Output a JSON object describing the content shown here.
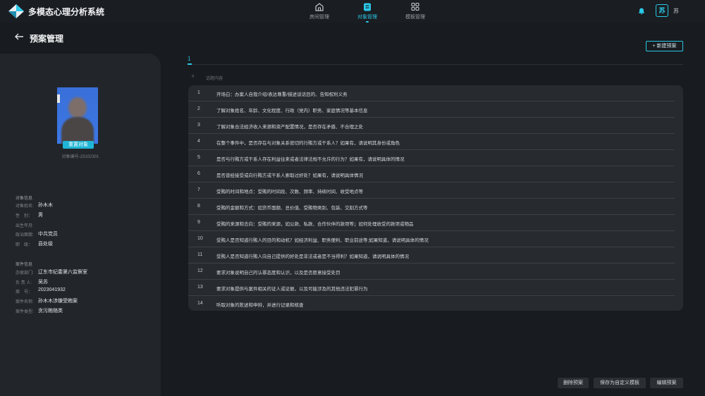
{
  "app": {
    "title": "多模态心理分析系统"
  },
  "nav": {
    "items": [
      {
        "label": "房间管理",
        "icon": "home-icon"
      },
      {
        "label": "对象管理",
        "icon": "person-card-icon"
      },
      {
        "label": "模板管理",
        "icon": "template-icon"
      }
    ],
    "active_index": 1
  },
  "user": {
    "avatar_text": "苏",
    "name": "苏"
  },
  "page": {
    "title": "预案管理"
  },
  "object": {
    "reset_label": "重置对象",
    "id_text": "对象编号-23102301",
    "info_title": "对象信息",
    "fields": [
      {
        "k": "对象姓名:",
        "v": "孙木木"
      },
      {
        "k": "性　别：",
        "v": "男"
      },
      {
        "k": "出生年月:",
        "v": ""
      },
      {
        "k": "政治面貌:",
        "v": "中共党员"
      },
      {
        "k": "职　级：",
        "v": "县处级"
      }
    ]
  },
  "case": {
    "info_title": "案件信息",
    "fields": [
      {
        "k": "办案部门:",
        "v": "辽东市纪委第六监察室"
      },
      {
        "k": "负 责 人:",
        "v": "吴苏"
      },
      {
        "k": "案　号：",
        "v": "2023041932"
      },
      {
        "k": "案件名称:",
        "v": "孙木木涉嫌受贿案"
      },
      {
        "k": "案件类型:",
        "v": "贪污贿赂类"
      }
    ]
  },
  "toolbar": {
    "new_label": "+ 新建预案"
  },
  "tabs": [
    {
      "label": "1"
    }
  ],
  "table": {
    "headers": {
      "no": "#",
      "content": "话题内容"
    },
    "rows": [
      {
        "no": "1",
        "text": "开场白：办案人自我介绍/表达尊重/描述谈话目的、告知权利义务"
      },
      {
        "no": "2",
        "text": "了解对象姓名、年龄、文化程度、行政（党内）职务、家庭情况等基本信息"
      },
      {
        "no": "3",
        "text": "了解对象合法经济收入来源和资产配置情况，是否存在矛盾、不合理之处"
      },
      {
        "no": "4",
        "text": "在整个事件中，是否存在与对象关系密切的行贿方或干系人？如果有，请说明其身份或角色"
      },
      {
        "no": "5",
        "text": "是否与行贿方或干系人存在利益往来或者法律法规不允许的行为？如果有，请说明具体的情况"
      },
      {
        "no": "6",
        "text": "是否曾经接受或向行贿方或干系人索取过好处？如果有，请说明具体情况"
      },
      {
        "no": "7",
        "text": "受贿的时间和地点：受贿的时间段、次数、频率、持续时间、收受地点等"
      },
      {
        "no": "8",
        "text": "受贿的金额和方式：如货币面额、总价值、受贿物类别、包装、交割方式等"
      },
      {
        "no": "9",
        "text": "受贿的来源和去向：受贿的来源，如公款、私款、合作伙伴的款项等；如何处理收受的款项或物品"
      },
      {
        "no": "10",
        "text": "受贿人是否知道行贿人的目的和动机？如经济利益、职务便利、职业前途等;如果知道，请说明具体的情况"
      },
      {
        "no": "11",
        "text": "受贿人是否知道行贿人向自己提供的好处是非法或者是不当得利？如果知道，请说明具体的情况"
      },
      {
        "no": "12",
        "text": "要求对象说明自己的认罪态度和认识，以及是否愿意接受处罚"
      },
      {
        "no": "13",
        "text": "要求对象提供与案件相关的证人或证据，以及可能涉及的其他违法犯罪行为"
      },
      {
        "no": "14",
        "text": "听取对象的陈述和申辩，并进行记录和核查"
      }
    ]
  },
  "actions": {
    "delete_label": "删除预案",
    "save_template_label": "保存为自定义模板",
    "edit_label": "编辑预案"
  },
  "colors": {
    "accent": "#2ac8e8",
    "background": "#181b1f",
    "panel": "#22262b"
  }
}
